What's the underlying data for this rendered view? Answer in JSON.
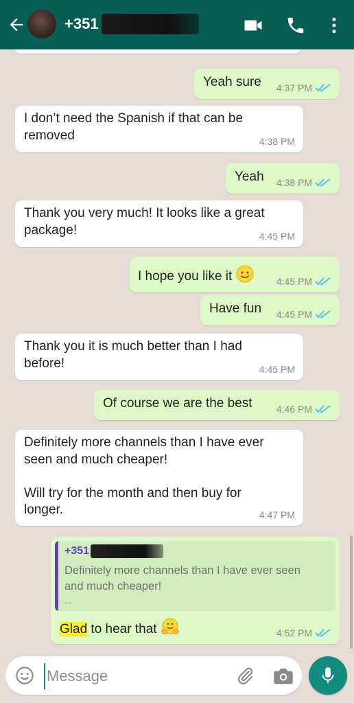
{
  "colors": {
    "header_bg": "#075e54",
    "incoming_bubble": "#ffffff",
    "outgoing_bubble": "#dcf8c6",
    "read_ticks": "#4fc3f7",
    "accent": "#128c7e",
    "quote_author": "#5d3fc3",
    "highlight": "#ffef1f"
  },
  "header": {
    "contact_prefix": "+351",
    "icons": [
      "back-arrow-icon",
      "video-call-icon",
      "phone-call-icon",
      "more-options-icon"
    ]
  },
  "messages": [
    {
      "dir": "out",
      "text": "Yeah sure",
      "time": "4:37 PM",
      "status": "read"
    },
    {
      "dir": "in",
      "lines": [
        "I don’t need the Spanish if that can be",
        "removed"
      ],
      "time": "4:38 PM"
    },
    {
      "dir": "out",
      "text": "Yeah",
      "time": "4:38 PM",
      "status": "read"
    },
    {
      "dir": "in",
      "lines": [
        "Thank you very much! It looks like a great",
        "package!"
      ],
      "time": "4:45 PM"
    },
    {
      "dir": "out",
      "text": "I hope you like it",
      "emoji": "smiling-face-emoji",
      "time": "4:45 PM",
      "status": "read"
    },
    {
      "dir": "out",
      "text": "Have fun",
      "time": "4:45 PM",
      "status": "read"
    },
    {
      "dir": "in",
      "lines": [
        "Thank you it is much better than I had",
        "before!"
      ],
      "time": "4:45 PM"
    },
    {
      "dir": "out",
      "text": "Of course we are the best",
      "time": "4:46 PM",
      "status": "read"
    },
    {
      "dir": "in",
      "lines": [
        "Definitely more channels than I have ever",
        "seen and much cheaper!",
        "",
        "Will try for the month and then buy for",
        "longer."
      ],
      "time": "4:47 PM"
    },
    {
      "dir": "out",
      "reply": {
        "author_prefix": "+351 9",
        "lines": [
          "Definitely more channels than I have ever seen",
          "and much cheaper!"
        ],
        "ellipsis": "..."
      },
      "highlight": "Glad",
      "text_rest": " to hear that",
      "emoji": "hugging-face-emoji",
      "time": "4:52 PM",
      "status": "read"
    }
  ],
  "composer": {
    "placeholder": "Message",
    "icons": [
      "emoji-icon",
      "attach-icon",
      "camera-icon",
      "mic-icon"
    ]
  }
}
